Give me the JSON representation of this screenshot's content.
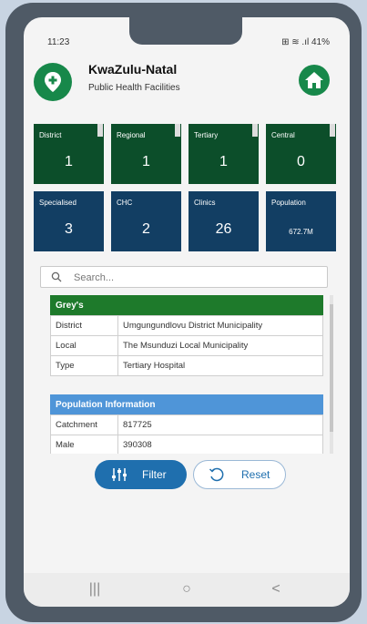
{
  "status_bar": {
    "time": "11:23",
    "icons": "⊞ ≋ .ıl 41%"
  },
  "header": {
    "title": "KwaZulu-Natal",
    "subtitle": "Public Health Facilities"
  },
  "tiles": [
    {
      "label": "District",
      "value": "1"
    },
    {
      "label": "Regional",
      "value": "1"
    },
    {
      "label": "Tertiary",
      "value": "1"
    },
    {
      "label": "Central",
      "value": "0"
    },
    {
      "label": "Specialised",
      "value": "3"
    },
    {
      "label": "CHC",
      "value": "2"
    },
    {
      "label": "Clinics",
      "value": "26"
    },
    {
      "label": "Population",
      "value": "672.7M"
    }
  ],
  "search": {
    "placeholder": "Search..."
  },
  "facility": {
    "name": "Grey's",
    "rows": [
      {
        "key": "District",
        "value": "Umgungundlovu District Municipality"
      },
      {
        "key": "Local",
        "value": "The Msunduzi Local Municipality"
      },
      {
        "key": "Type",
        "value": "Tertiary Hospital"
      }
    ]
  },
  "population": {
    "title": "Population Information",
    "rows": [
      {
        "key": "Catchment",
        "value": "817725"
      },
      {
        "key": "Male",
        "value": "390308"
      }
    ]
  },
  "buttons": {
    "filter_label": "Filter",
    "reset_label": "Reset"
  },
  "nav": {
    "recent": "|||",
    "home": "○",
    "back": "<"
  },
  "colors": {
    "primary_green": "#17884a",
    "tile_green": "#0c4e2a",
    "tile_blue": "#123e63",
    "section_green": "#1e7a2b",
    "section_blue": "#4f95d8",
    "filter_blue": "#1f6fae"
  },
  "icons": [
    "location-plus-icon",
    "home-icon",
    "search-icon",
    "sliders-icon",
    "reset-icon"
  ]
}
